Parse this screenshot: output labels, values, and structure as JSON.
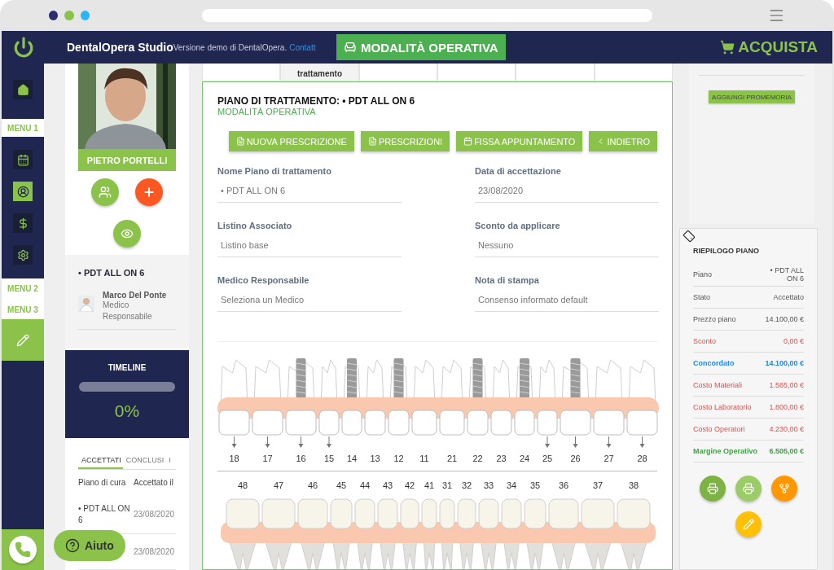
{
  "header": {
    "app_name": "DentalOpera Studio",
    "demo_note": "Versione demo di DentalOpera.",
    "link": "Contatt",
    "mode_badge": "MODALITÀ OPERATIVA",
    "buy_button": "ACQUISTA"
  },
  "nav": {
    "top_icons": [
      {
        "selected": false
      }
    ],
    "menu_1": "MENU 1",
    "icons": [
      {
        "selected": false
      },
      {
        "selected": true
      },
      {
        "selected": false
      },
      {
        "selected": false
      }
    ],
    "menu_2": "MENU 2",
    "menu_3": "MENU 3"
  },
  "patient": {
    "name": "PIETRO PORTELLI",
    "plan": "• PDT ALL ON 6",
    "doctor_name": "Marco Del Ponte",
    "doctor_role": "Medico Responsabile"
  },
  "timeline": {
    "title": "TIMELINE",
    "level": 0,
    "percent": "0%"
  },
  "plan_tabs": [
    {
      "label": "ACCETTATI",
      "selected": true
    },
    {
      "label": "CONCLUSI",
      "selected": false
    },
    {
      "label": "I",
      "selected": false
    }
  ],
  "plan_table": {
    "columns": [
      "Piano di cura",
      "Accettato il"
    ],
    "rows": [
      {
        "plan": "• PDT ALL ON 6",
        "date": "23/08/2020"
      },
      {
        "date": "23/08/2020"
      }
    ]
  },
  "help_button": "Aiuto",
  "tabs": [
    {
      "selected": false
    },
    {
      "label": "trattamento",
      "selected": true
    },
    {
      "selected": false
    },
    {
      "selected": false
    },
    {
      "selected": false
    },
    {
      "selected": false
    }
  ],
  "plan": {
    "title": "PIANO DI TRATTAMENTO: • PDT ALL ON 6",
    "mode": "MODALITÀ OPERATIVA"
  },
  "actions": [
    "NUOVA PRESCRIZIONE",
    "PRESCRIZIONI",
    "FISSA APPUNTAMENTO",
    "INDIETRO"
  ],
  "fields": [
    {
      "label": "Nome Piano di trattamento",
      "value": "• PDT ALL ON 6"
    },
    {
      "label": "Data di accettazione",
      "value": "23/08/2020"
    },
    {
      "label": "Listino Associato",
      "value": "Listino base"
    },
    {
      "label": "Sconto da applicare",
      "value": "Nessuno"
    },
    {
      "label": "Medico Responsabile",
      "value": "Seleziona un Medico"
    },
    {
      "label": "Nota di stampa",
      "value": "Consenso informato default"
    }
  ],
  "upper_teeth": [
    {
      "number": "18",
      "implant": false,
      "arrow": true
    },
    {
      "number": "17",
      "implant": false,
      "arrow": true
    },
    {
      "number": "16",
      "implant": true,
      "arrow": true
    },
    {
      "number": "15",
      "implant": false,
      "arrow": true
    },
    {
      "number": "14",
      "implant": true,
      "arrow": false
    },
    {
      "number": "13",
      "implant": false,
      "arrow": false
    },
    {
      "number": "12",
      "implant": true,
      "arrow": false
    },
    {
      "number": "11",
      "implant": false,
      "arrow": false
    },
    {
      "number": "21",
      "implant": false,
      "arrow": false
    },
    {
      "number": "22",
      "implant": true,
      "arrow": false
    },
    {
      "number": "23",
      "implant": false,
      "arrow": false
    },
    {
      "number": "24",
      "implant": true,
      "arrow": false
    },
    {
      "number": "25",
      "implant": false,
      "arrow": true
    },
    {
      "number": "26",
      "implant": true,
      "arrow": true
    },
    {
      "number": "27",
      "implant": false,
      "arrow": true
    },
    {
      "number": "28",
      "implant": false,
      "arrow": true
    }
  ],
  "lower_teeth": [
    "48",
    "47",
    "46",
    "45",
    "44",
    "43",
    "42",
    "41",
    "31",
    "32",
    "33",
    "34",
    "35",
    "36",
    "37",
    "38"
  ],
  "reminder_button": "AGGIUNGI PROMEMORIA",
  "summary": {
    "title": "RIEPILOGO PIANO",
    "rows": [
      {
        "label": "Piano",
        "value": "• PDT ALL ON 6",
        "kind": "plain"
      },
      {
        "label": "Stato",
        "value": "Accettato",
        "kind": "plain"
      },
      {
        "label": "Prezzo piano",
        "value": "14.100,00 €",
        "kind": "plain"
      },
      {
        "label": "Sconto",
        "value": "0,00 €",
        "kind": "cost"
      },
      {
        "label": "Concordato",
        "value": "14.100,00 €",
        "kind": "total"
      },
      {
        "label": "Costo Materiali",
        "value": "1.565,00 €",
        "kind": "cost"
      },
      {
        "label": "Costo Laboratorio",
        "value": "1.800,00 €",
        "kind": "cost"
      },
      {
        "label": "Costo Operatori",
        "value": "4.230,00 €",
        "kind": "cost"
      },
      {
        "label": "Margine Operativo",
        "value": "6.505,00 €",
        "kind": "margin"
      }
    ]
  }
}
